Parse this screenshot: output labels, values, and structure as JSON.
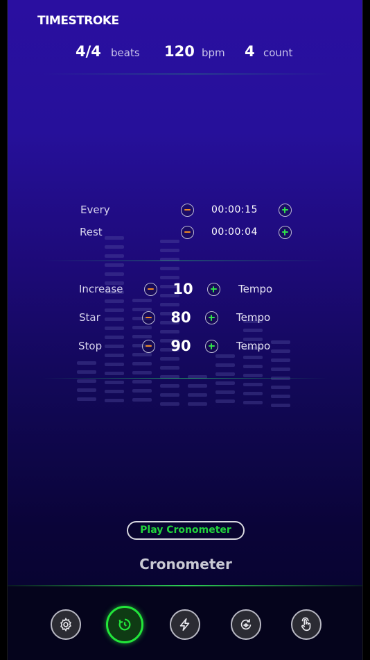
{
  "app": {
    "logo_text": "TIMESTROKE"
  },
  "header": {
    "beats_value": "4/4",
    "beats_label": "beats",
    "bpm_value": "120",
    "bpm_label": "bpm",
    "count_value": "4",
    "count_label": "count"
  },
  "timer": {
    "every_label": "Every",
    "every_value": "00:00:15",
    "rest_label": "Rest",
    "rest_value": "00:00:04"
  },
  "tempo": {
    "increase_label": "Increase",
    "increase_value": "10",
    "star_label": "Star",
    "star_value": "80",
    "stop_label": "Stop",
    "stop_value": "90",
    "unit_label": "Tempo"
  },
  "actions": {
    "play_label": "Play Cronometer"
  },
  "mode": {
    "title": "Cronometer"
  },
  "nav": {
    "items": [
      {
        "icon": "gear-icon",
        "active": false
      },
      {
        "icon": "cronometer-icon",
        "active": true
      },
      {
        "icon": "lightning-icon",
        "active": false
      },
      {
        "icon": "cycle-icon",
        "active": false
      },
      {
        "icon": "tap-icon",
        "active": false
      }
    ]
  },
  "colors": {
    "accent_green": "#22e63a",
    "minus_orange": "#f08a24",
    "background_top": "#2a0fa0",
    "background_bottom": "#06032a"
  }
}
